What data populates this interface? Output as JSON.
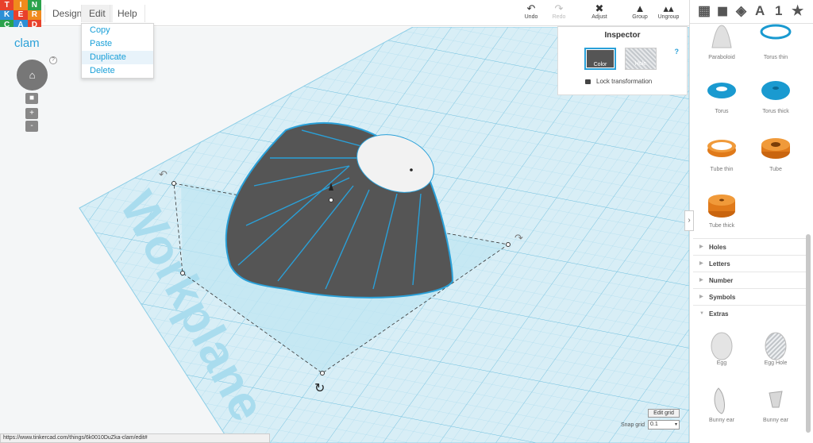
{
  "logo": {
    "letters": [
      "T",
      "I",
      "N",
      "K",
      "E",
      "R",
      "C",
      "A",
      "D"
    ],
    "colors": [
      "#e8412b",
      "#f08a1c",
      "#2ba24c",
      "#2c8fd6",
      "#e8412b",
      "#f08a1c",
      "#2ba24c",
      "#2c8fd6",
      "#e8412b"
    ]
  },
  "menu": {
    "design": "Design",
    "edit": "Edit",
    "help": "Help"
  },
  "edit_menu": {
    "items": [
      "Copy",
      "Paste",
      "Duplicate",
      "Delete"
    ],
    "highlighted": "Duplicate"
  },
  "toolbar": {
    "undo": "Undo",
    "redo": "Redo",
    "adjust": "Adjust",
    "group": "Group",
    "ungroup": "Ungroup"
  },
  "design_name": "clam",
  "help_mark": "?",
  "inspector": {
    "title": "Inspector",
    "color_label": "Color",
    "hole_label": "Hole",
    "lock_label": "Lock transformation",
    "help": "?"
  },
  "workplane_label": "Workplane",
  "panel": {
    "view_tools": [
      "grid-view",
      "cube-view",
      "gem-view",
      "text-view",
      "number-view",
      "star-view"
    ],
    "letters_tool": "A",
    "number_tool": "1",
    "shapes_top": [
      "Paraboloid",
      "Torus thin",
      "Torus",
      "Torus thick",
      "Tube thin",
      "Tube",
      "Tube thick"
    ],
    "categories": [
      "Holes",
      "Letters",
      "Number",
      "Symbols",
      "Extras"
    ],
    "extras": [
      "Egg",
      "Egg Hole",
      "Bunny ear",
      "Bunny ear"
    ]
  },
  "status_url": "https://www.tinkercad.com/things/6k0010DuZka-clam/edit#",
  "grid": {
    "edit_label": "Edit grid",
    "snap_label": "Snap grid",
    "snap_value": "0.1"
  },
  "colors": {
    "accent": "#2aa0d8",
    "shape_orange": "#e07a1a",
    "shape_blue": "#1a9ad0",
    "workplane": "#bfe6f2"
  }
}
